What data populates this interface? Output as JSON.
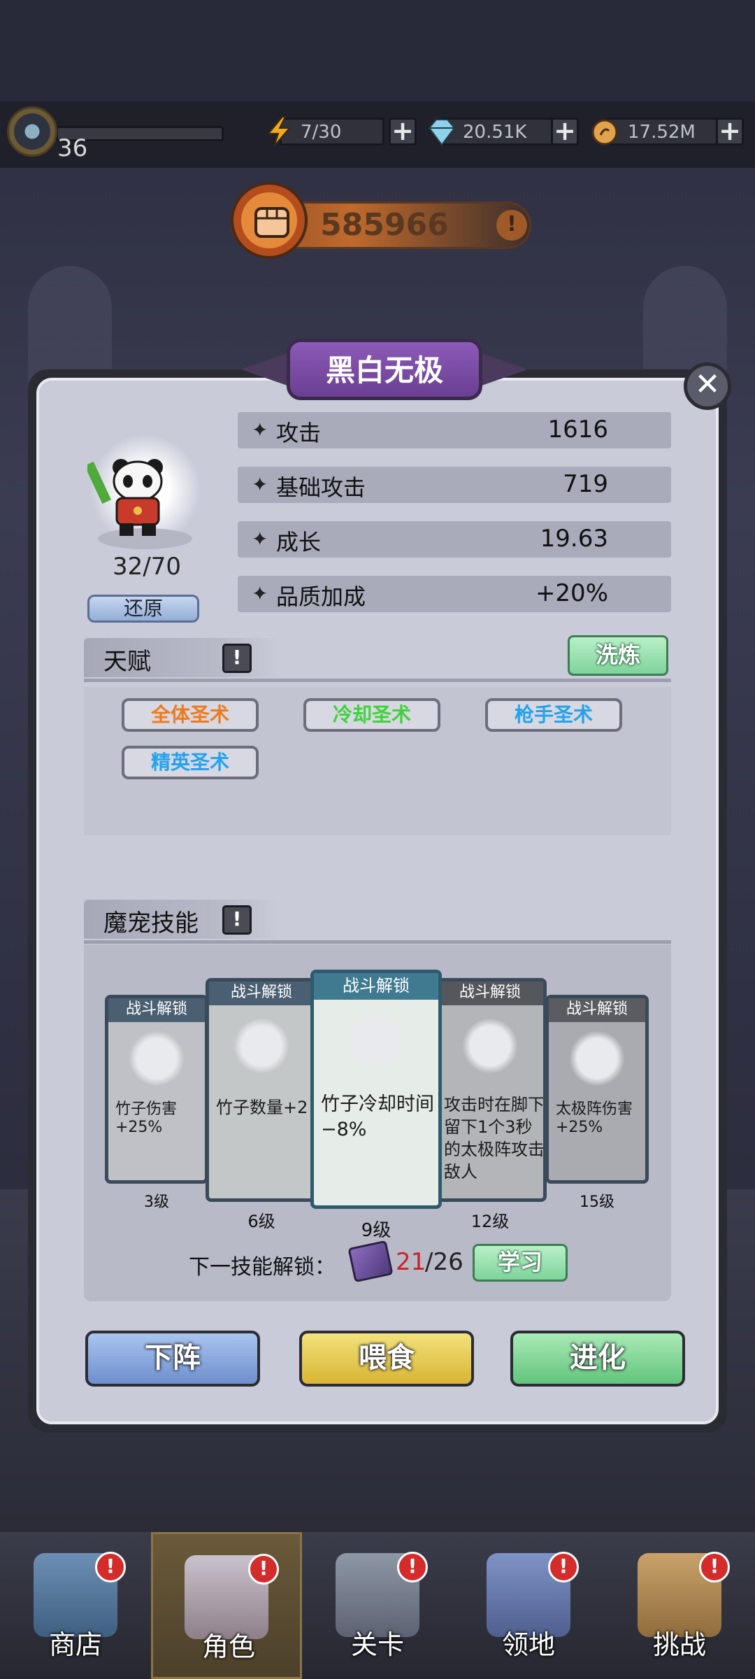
{
  "player": {
    "level": "36"
  },
  "resources": [
    {
      "icon": "energy-bolt-icon",
      "value": "7/30"
    },
    {
      "icon": "diamond-icon",
      "value": "20.51K"
    },
    {
      "icon": "gold-coin-icon",
      "value": "17.52M"
    }
  ],
  "power": {
    "value": "585966"
  },
  "pet": {
    "name": "黑白无极",
    "level": "32/70",
    "restore_label": "还原",
    "stats": [
      {
        "label": "攻击",
        "value": "1616"
      },
      {
        "label": "基础攻击",
        "value": "719"
      },
      {
        "label": "成长",
        "value": "19.63"
      },
      {
        "label": "品质加成",
        "value": "+20%"
      }
    ]
  },
  "talent": {
    "title": "天赋",
    "refine_label": "洗炼",
    "chips": [
      {
        "label": "全体圣术",
        "color": "#f07a1a"
      },
      {
        "label": "冷却圣术",
        "color": "#3fd23a"
      },
      {
        "label": "枪手圣术",
        "color": "#23a2ee"
      },
      {
        "label": "精英圣术",
        "color": "#23a2ee"
      }
    ]
  },
  "skills": {
    "title": "魔宠技能",
    "cards": [
      {
        "header": "战斗解锁",
        "desc": "竹子伤害+25%",
        "level": "3级"
      },
      {
        "header": "战斗解锁",
        "desc": "竹子数量+2",
        "level": "6级"
      },
      {
        "header": "战斗解锁",
        "desc": "竹子冷却时间−8%",
        "level": "9级"
      },
      {
        "header": "战斗解锁",
        "desc": "攻击时在脚下留下1个3秒的太极阵攻击敌人",
        "level": "12级"
      },
      {
        "header": "战斗解锁",
        "desc": "太极阵伤害+25%",
        "level": "15级"
      }
    ],
    "unlock_label": "下一技能解锁：",
    "unlock_current": "21",
    "unlock_total": "/26",
    "learn_label": "学习"
  },
  "actions": {
    "withdraw": "下阵",
    "feed": "喂食",
    "evolve": "进化"
  },
  "nav": [
    {
      "label": "商店",
      "badge": "!"
    },
    {
      "label": "角色",
      "badge": "!"
    },
    {
      "label": "关卡",
      "badge": "!"
    },
    {
      "label": "领地",
      "badge": "!"
    },
    {
      "label": "挑战",
      "badge": "!"
    }
  ]
}
